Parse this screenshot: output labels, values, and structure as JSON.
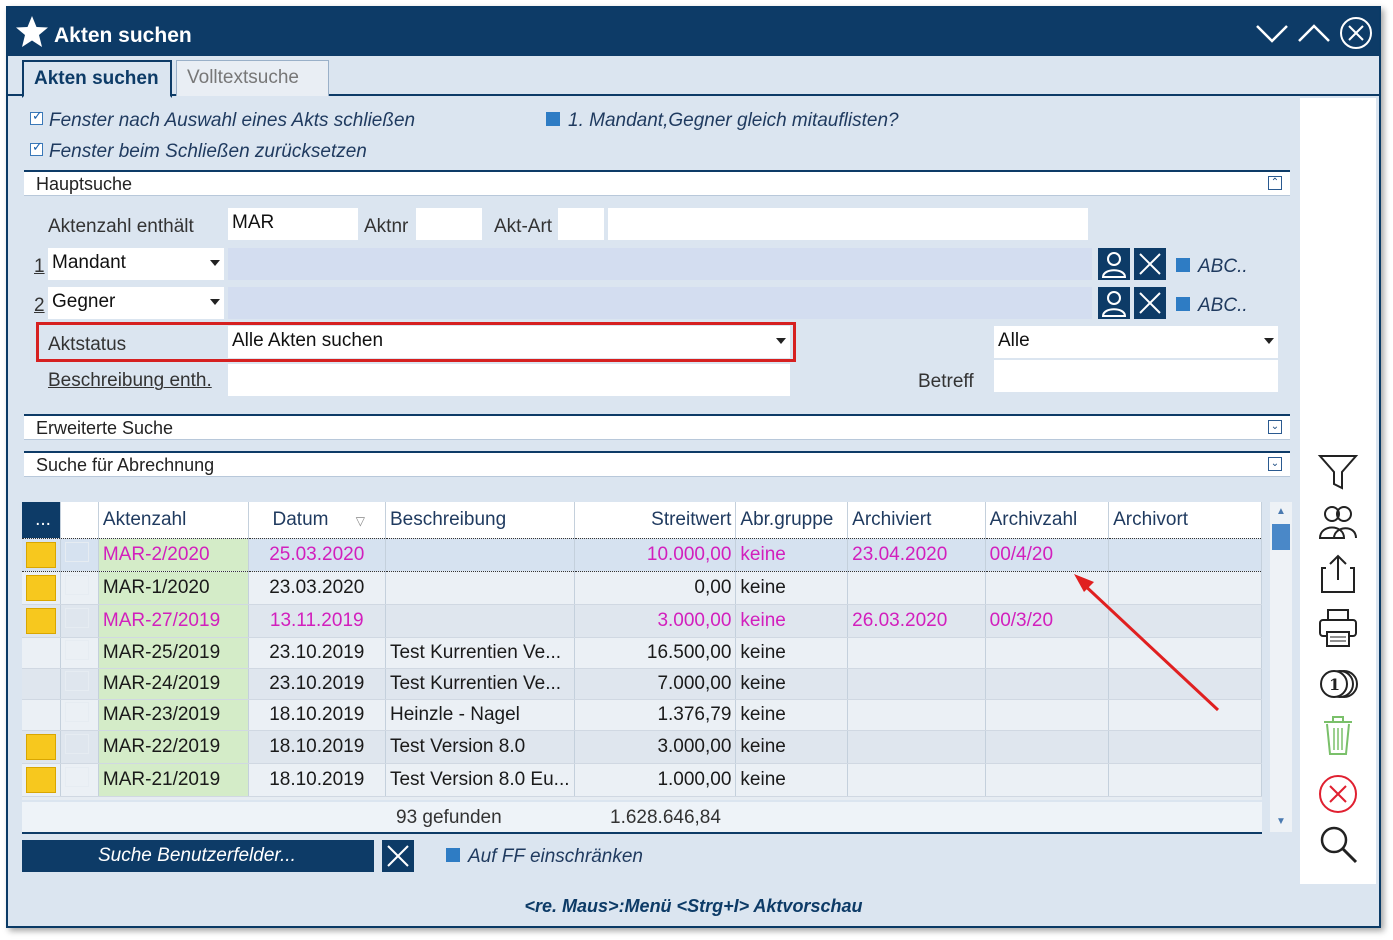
{
  "window": {
    "title": "Akten suchen"
  },
  "tabs": [
    {
      "label": "Akten suchen",
      "active": true
    },
    {
      "label": "Volltextsuche",
      "active": false
    }
  ],
  "options": {
    "close_after_select": {
      "label": "Fenster nach Auswahl eines Akts schließen",
      "checked": true
    },
    "reset_on_close": {
      "label": "Fenster beim Schließen zurücksetzen",
      "checked": true
    },
    "list_parties": {
      "label": "1. Mandant,Gegner gleich mitauflisten?",
      "checked": false
    }
  },
  "hauptsuche": {
    "title": "Hauptsuche",
    "aktenzahl_label": "Aktenzahl enthält",
    "aktenzahl_value": "MAR",
    "aktnr_label": "Aktnr",
    "aktnr_value": "",
    "aktart_label": "Akt-Art",
    "aktart_value": "",
    "aktart_desc": "",
    "party1": {
      "num": "1",
      "role": "Mandant",
      "value": "",
      "abc": "ABC.."
    },
    "party2": {
      "num": "2",
      "role": "Gegner",
      "value": "",
      "abc": "ABC.."
    },
    "aktstatus_label": "Aktstatus",
    "aktstatus_value": "Alle Akten suchen",
    "alle_value": "Alle",
    "beschreibung_label": "Beschreibung enth.",
    "beschreibung_value": "",
    "betreff_label": "Betreff",
    "betreff_value": ""
  },
  "sections": {
    "erweitert": "Erweiterte Suche",
    "abrechnung": "Suche für Abrechnung"
  },
  "grid": {
    "menu_label": "...",
    "columns": [
      "Aktenzahl",
      "Datum",
      "Beschreibung",
      "Streitwert",
      "Abr.gruppe",
      "Archiviert",
      "Archivzahl",
      "Archivort"
    ],
    "rows": [
      {
        "note": true,
        "aktenzahl": "MAR-2/2020",
        "datum": "25.03.2020",
        "beschreibung": "",
        "streitwert": "10.000,00",
        "abr": "keine",
        "archiviert": "23.04.2020",
        "archivzahl": "00/4/20",
        "archivort": "",
        "pink": true,
        "selected": true
      },
      {
        "note": true,
        "aktenzahl": "MAR-1/2020",
        "datum": "23.03.2020",
        "beschreibung": "",
        "streitwert": "0,00",
        "abr": "keine",
        "archiviert": "",
        "archivzahl": "",
        "archivort": "",
        "pink": false,
        "selected": false
      },
      {
        "note": true,
        "aktenzahl": "MAR-27/2019",
        "datum": "13.11.2019",
        "beschreibung": "",
        "streitwert": "3.000,00",
        "abr": "keine",
        "archiviert": "26.03.2020",
        "archivzahl": "00/3/20",
        "archivort": "",
        "pink": true,
        "selected": false
      },
      {
        "note": false,
        "aktenzahl": "MAR-25/2019",
        "datum": "23.10.2019",
        "beschreibung": "Test Kurrentien Ve...",
        "streitwert": "16.500,00",
        "abr": "keine",
        "archiviert": "",
        "archivzahl": "",
        "archivort": "",
        "pink": false,
        "selected": false
      },
      {
        "note": false,
        "aktenzahl": "MAR-24/2019",
        "datum": "23.10.2019",
        "beschreibung": "Test Kurrentien Ve...",
        "streitwert": "7.000,00",
        "abr": "keine",
        "archiviert": "",
        "archivzahl": "",
        "archivort": "",
        "pink": false,
        "selected": false
      },
      {
        "note": false,
        "aktenzahl": "MAR-23/2019",
        "datum": "18.10.2019",
        "beschreibung": "Heinzle - Nagel",
        "streitwert": "1.376,79",
        "abr": "keine",
        "archiviert": "",
        "archivzahl": "",
        "archivort": "",
        "pink": false,
        "selected": false
      },
      {
        "note": true,
        "aktenzahl": "MAR-22/2019",
        "datum": "18.10.2019",
        "beschreibung": "Test Version 8.0",
        "streitwert": "3.000,00",
        "abr": "keine",
        "archiviert": "",
        "archivzahl": "",
        "archivort": "",
        "pink": false,
        "selected": false
      },
      {
        "note": true,
        "aktenzahl": "MAR-21/2019",
        "datum": "18.10.2019",
        "beschreibung": "Test Version 8.0 Eu...",
        "streitwert": "1.000,00",
        "abr": "keine",
        "archiviert": "",
        "archivzahl": "",
        "archivort": "",
        "pink": false,
        "selected": false
      }
    ],
    "found": "93 gefunden",
    "total": "1.628.646,84"
  },
  "bottom": {
    "user_fields_button": "Suche Benutzerfelder...",
    "ff_restrict": {
      "label": "Auf FF einschränken",
      "checked": false
    },
    "hint": "<re. Maus>:Menü  <Strg+I> Aktvorschau"
  },
  "icons": {
    "title": "star-icon",
    "side": [
      "filter-icon",
      "persons-icon",
      "export-icon",
      "print-icon",
      "coins-icon",
      "trash-icon",
      "cancel-icon",
      "search-icon"
    ]
  },
  "colors": {
    "titlebar": "#0d3b67",
    "pink_text": "#d21fbd",
    "note_yellow": "#f7c81e",
    "aktenzahl_green": "#d4ecc8",
    "annotation_red": "#e02020"
  }
}
